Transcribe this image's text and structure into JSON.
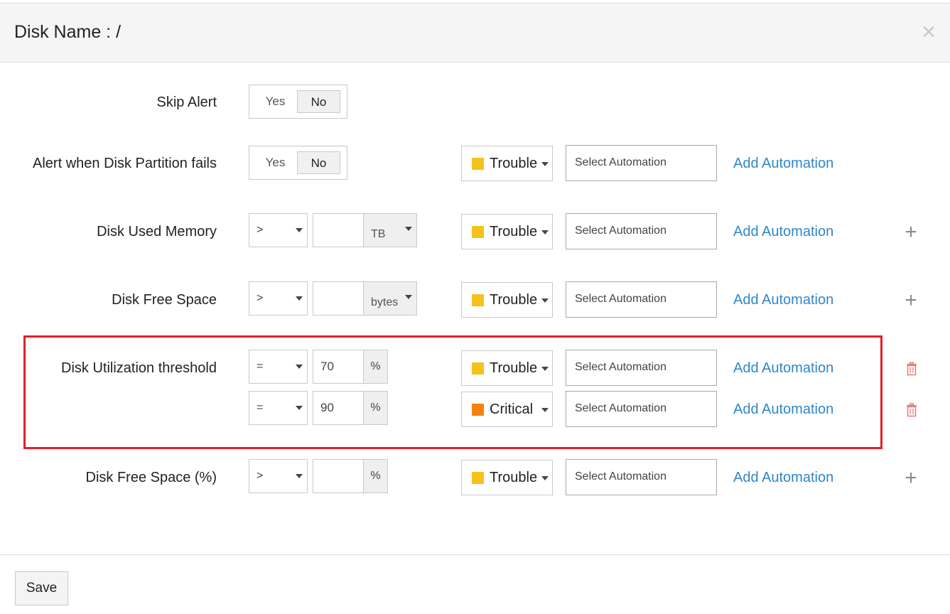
{
  "header": {
    "title": "Disk Name : /",
    "close_label": "×"
  },
  "colors": {
    "trouble": "#f5c21c",
    "critical": "#f5830f",
    "link": "#2f86c9",
    "highlight": "#e3202a",
    "trash": "#e8716f"
  },
  "rows": {
    "skip_alert": {
      "label": "Skip Alert",
      "yes": "Yes",
      "no": "No",
      "selected": "No"
    },
    "partition_fails": {
      "label": "Alert when Disk Partition fails",
      "yes": "Yes",
      "no": "No",
      "selected": "No",
      "severity": "Trouble",
      "automation_placeholder": "Select Automation",
      "add_automation": "Add Automation"
    },
    "used_memory": {
      "label": "Disk Used Memory",
      "operator": ">",
      "value": "",
      "unit": "TB",
      "severity": "Trouble",
      "automation_placeholder": "Select Automation",
      "add_automation": "Add Automation",
      "add_icon": "+"
    },
    "free_space": {
      "label": "Disk Free Space",
      "operator": ">",
      "value": "",
      "unit": "bytes",
      "severity": "Trouble",
      "automation_placeholder": "Select Automation",
      "add_automation": "Add Automation",
      "add_icon": "+"
    },
    "utilization": {
      "label": "Disk Utilization threshold",
      "thresholds": [
        {
          "operator": "=",
          "value": "70",
          "unit": "%",
          "severity": "Trouble",
          "automation_placeholder": "Select Automation",
          "add_automation": "Add Automation"
        },
        {
          "operator": "=",
          "value": "90",
          "unit": "%",
          "severity": "Critical",
          "automation_placeholder": "Select Automation",
          "add_automation": "Add Automation"
        }
      ]
    },
    "free_space_pct": {
      "label": "Disk Free Space (%)",
      "operator": ">",
      "value": "",
      "unit": "%",
      "severity": "Trouble",
      "automation_placeholder": "Select Automation",
      "add_automation": "Add Automation",
      "add_icon": "+"
    }
  },
  "footer": {
    "save_label": "Save"
  }
}
